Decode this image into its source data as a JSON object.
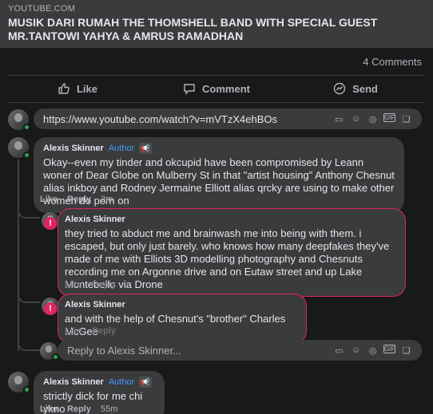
{
  "link": {
    "source": "YOUTUBE.COM",
    "title": "MUSIK DARI RUMAH THE THOMSHELL BAND WITH SPECIAL GUEST Mr.TANTOWI YAHYA & AMRUS RAMADHAN"
  },
  "comments_count": "4 Comments",
  "actions": {
    "like": "Like",
    "comment": "Comment",
    "send": "Send"
  },
  "compose": {
    "value": "https://www.youtube.com/watch?v=mVTzX4ehBOs"
  },
  "reply_compose": {
    "placeholder": "Reply to Alexis Skinner..."
  },
  "comments": [
    {
      "author": "Alexis Skinner",
      "tag": "Author",
      "text": "Okay--even my tinder and okcupid have been compromised by Leann woner of Dear Globe on Mulberry St in that \"artist housing\" Anthony Chesnut alias inkboy and Rodney Jermaine Elliott alias qrcky are using to make other women do porn on",
      "like": "Like",
      "reply": "Reply",
      "time": "2m"
    },
    {
      "author": "Alexis Skinner",
      "text": "they tried to abduct me and brainwash me into being with them. i escaped, but only just barely. who knows how many deepfakes they've made of me with Elliots 3D modelling photography and Chesnuts recording me on Argonne drive and on Eutaw street and up Lake Montebello via Drone",
      "like": "Like",
      "reply": "Reply"
    },
    {
      "author": "Alexis Skinner",
      "text": "and with the help of Chesnut's \"brother\" Charles McGee",
      "like": "Like",
      "reply": "Reply"
    },
    {
      "author": "Alexis Skinner",
      "tag": "Author",
      "text": "strictly dick for me chi ykno",
      "like": "Like",
      "reply": "Reply",
      "time": "55m"
    }
  ],
  "colors": {
    "background": "#18191a",
    "surface": "#3a3b3c",
    "accent": "#4599ff",
    "error": "#e0245e",
    "online": "#31a24c"
  }
}
